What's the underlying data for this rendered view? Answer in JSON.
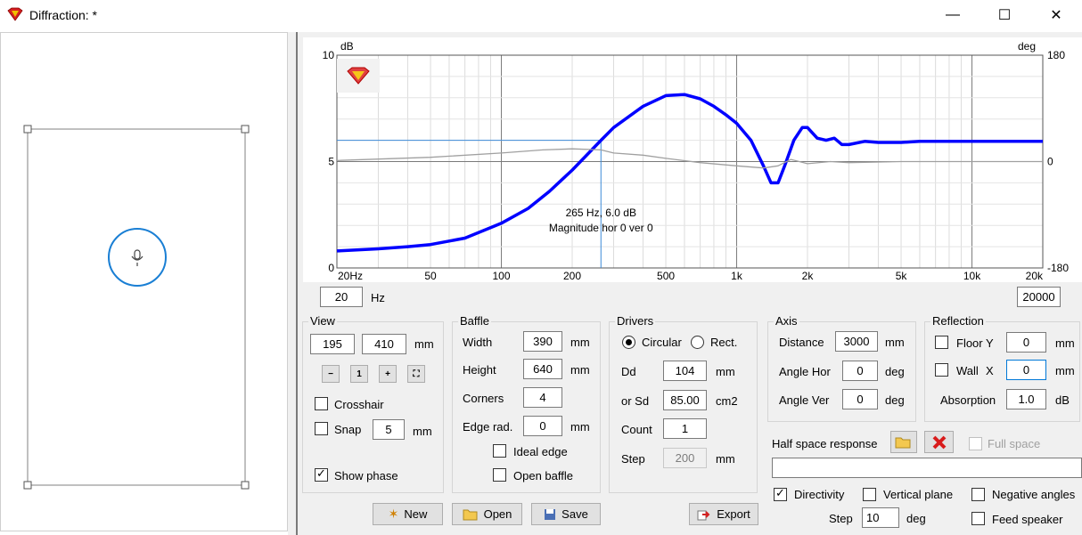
{
  "window": {
    "title": "Diffraction: *",
    "minimize": "—",
    "maximize": "☐",
    "close": "✕"
  },
  "chart_data": {
    "type": "line",
    "ylabel_left": "dB",
    "ylabel_right": "deg",
    "ylim": [
      0,
      10
    ],
    "ylim_right": [
      -180,
      180
    ],
    "left_ticks": [
      "10",
      "5",
      "0"
    ],
    "right_ticks": [
      "180",
      "0",
      "-180"
    ],
    "x_tick_labels": [
      "20Hz",
      "50",
      "100",
      "200",
      "500",
      "1k",
      "2k",
      "5k",
      "10k",
      "20k"
    ],
    "x_tick_values": [
      20,
      50,
      100,
      200,
      500,
      1000,
      2000,
      5000,
      10000,
      20000
    ],
    "xscale": "log",
    "xlim": [
      20,
      20000
    ],
    "series": [
      {
        "color": "#0000ff",
        "x": [
          20,
          30,
          40,
          50,
          70,
          100,
          130,
          160,
          200,
          265,
          300,
          400,
          500,
          600,
          700,
          800,
          900,
          1000,
          1150,
          1300,
          1400,
          1500,
          1600,
          1750,
          1900,
          2000,
          2200,
          2400,
          2600,
          2800,
          3000,
          3500,
          4000,
          5000,
          6000,
          8000,
          10000,
          15000,
          20000
        ],
        "y": [
          0.8,
          0.9,
          1.0,
          1.1,
          1.4,
          2.1,
          2.8,
          3.6,
          4.6,
          6.0,
          6.6,
          7.6,
          8.1,
          8.15,
          7.95,
          7.6,
          7.2,
          6.8,
          6.0,
          4.8,
          4.0,
          4.0,
          4.8,
          6.0,
          6.6,
          6.6,
          6.1,
          6.0,
          6.1,
          5.8,
          5.8,
          5.95,
          5.9,
          5.9,
          5.95,
          5.95,
          5.95,
          5.95,
          5.95
        ]
      },
      {
        "color": "#a0a0a0",
        "x": [
          20,
          50,
          100,
          150,
          200,
          265,
          300,
          400,
          500,
          700,
          1000,
          1300,
          1500,
          1700,
          2000,
          2500,
          3000,
          5000,
          10000,
          20000
        ],
        "y": [
          5.05,
          5.2,
          5.4,
          5.55,
          5.6,
          5.55,
          5.4,
          5.3,
          5.15,
          4.95,
          4.8,
          4.7,
          4.8,
          5.1,
          4.9,
          5.0,
          4.95,
          5.0,
          5.0,
          5.0
        ]
      }
    ],
    "cursor": {
      "x": 265,
      "y": 6.0,
      "label1": "265 Hz, 6.0 dB",
      "label2": "Magnitude hor 0 ver 0"
    }
  },
  "range": {
    "min": "20",
    "unit": "Hz",
    "max": "20000"
  },
  "view": {
    "title": "View",
    "w": "195",
    "h": "410",
    "unit": "mm",
    "crosshair": "Crosshair",
    "snap": "Snap",
    "snap_val": "5",
    "snap_unit": "mm",
    "show_phase": "Show phase"
  },
  "baffle": {
    "title": "Baffle",
    "width_lbl": "Width",
    "width": "390",
    "height_lbl": "Height",
    "height": "640",
    "corners_lbl": "Corners",
    "corners": "4",
    "edge_lbl": "Edge rad.",
    "edge": "0",
    "unit": "mm",
    "ideal_edge": "Ideal edge",
    "open_baffle": "Open baffle"
  },
  "drivers": {
    "title": "Drivers",
    "circular": "Circular",
    "rect": "Rect.",
    "dd_lbl": "Dd",
    "dd": "104",
    "dd_unit": "mm",
    "sd_lbl": "or Sd",
    "sd": "85.00",
    "sd_unit": "cm2",
    "count_lbl": "Count",
    "count": "1",
    "step_lbl": "Step",
    "step": "200",
    "step_unit": "mm"
  },
  "axis": {
    "title": "Axis",
    "distance_lbl": "Distance",
    "distance": "3000",
    "distance_unit": "mm",
    "hor_lbl": "Angle Hor",
    "hor": "0",
    "hor_unit": "deg",
    "ver_lbl": "Angle Ver",
    "ver": "0",
    "ver_unit": "deg"
  },
  "reflection": {
    "title": "Reflection",
    "floor_lbl": "Floor Y",
    "floor": "0",
    "floor_unit": "mm",
    "wall_lbl": "Wall",
    "wall_x": "X",
    "wall": "0",
    "wall_unit": "mm",
    "abs_lbl": "Absorption",
    "abs": "1.0",
    "abs_unit": "dB"
  },
  "halfspace": {
    "label": "Half space response",
    "full_space": "Full space",
    "path": ""
  },
  "directivity": {
    "label": "Directivity",
    "vertical": "Vertical plane",
    "negative": "Negative angles",
    "step_lbl": "Step",
    "step": "10",
    "step_unit": "deg",
    "feed": "Feed speaker"
  },
  "buttons": {
    "new": "New",
    "open": "Open",
    "save": "Save",
    "export": "Export"
  }
}
